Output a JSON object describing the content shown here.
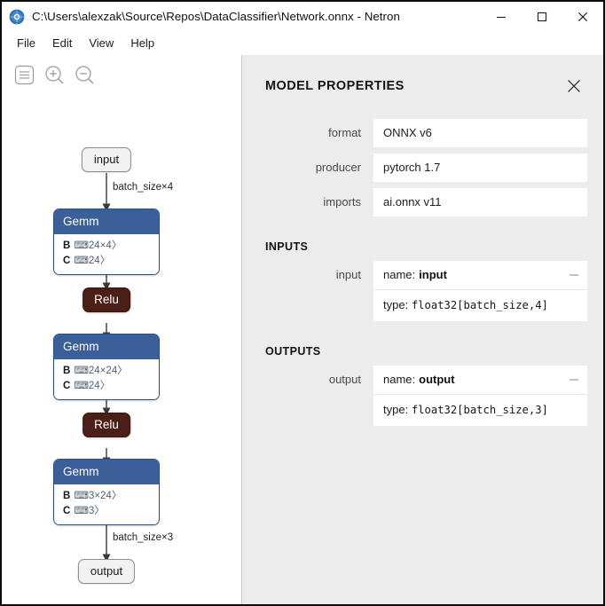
{
  "window": {
    "title": "C:\\Users\\alexzak\\Source\\Repos\\DataClassifier\\Network.onnx - Netron",
    "app_icon": "netron-logo-icon",
    "controls": {
      "minimize": "─",
      "maximize": "☐",
      "close": "✕"
    }
  },
  "menubar": {
    "items": [
      {
        "label": "File"
      },
      {
        "label": "Edit"
      },
      {
        "label": "View"
      },
      {
        "label": "Help"
      }
    ]
  },
  "toolbar": {
    "buttons": [
      {
        "icon": "menu-icon",
        "label": "Menu"
      },
      {
        "icon": "zoom-in-icon",
        "label": "Zoom In"
      },
      {
        "icon": "zoom-out-icon",
        "label": "Zoom Out"
      }
    ]
  },
  "graph": {
    "nodes": [
      {
        "id": "input",
        "kind": "io",
        "label": "input"
      },
      {
        "id": "gemm1",
        "kind": "op",
        "label": "Gemm",
        "attrs": [
          {
            "key": "B",
            "value": "⌨24×4〉"
          },
          {
            "key": "C",
            "value": "⌨24〉"
          }
        ]
      },
      {
        "id": "relu1",
        "kind": "act",
        "label": "Relu"
      },
      {
        "id": "gemm2",
        "kind": "op",
        "label": "Gemm",
        "attrs": [
          {
            "key": "B",
            "value": "⌨24×24〉"
          },
          {
            "key": "C",
            "value": "⌨24〉"
          }
        ]
      },
      {
        "id": "relu2",
        "kind": "act",
        "label": "Relu"
      },
      {
        "id": "gemm3",
        "kind": "op",
        "label": "Gemm",
        "attrs": [
          {
            "key": "B",
            "value": "⌨3×24〉"
          },
          {
            "key": "C",
            "value": "⌨3〉"
          }
        ]
      },
      {
        "id": "output",
        "kind": "io",
        "label": "output"
      }
    ],
    "edge_labels": [
      {
        "id": "e_in",
        "text": "batch_size×4"
      },
      {
        "id": "e_out",
        "text": "batch_size×3"
      }
    ]
  },
  "sidebar": {
    "title": "MODEL PROPERTIES",
    "close_icon": "close-icon",
    "properties": [
      {
        "label": "format",
        "value": "ONNX v6"
      },
      {
        "label": "producer",
        "value": "pytorch 1.7"
      },
      {
        "label": "imports",
        "value": "ai.onnx v11"
      }
    ],
    "inputs": {
      "section": "INPUTS",
      "items": [
        {
          "label": "input",
          "name_prefix": "name:",
          "name": "input",
          "type_prefix": "type:",
          "type": "float32[batch_size,4]"
        }
      ]
    },
    "outputs": {
      "section": "OUTPUTS",
      "items": [
        {
          "label": "output",
          "name_prefix": "name:",
          "name": "output",
          "type_prefix": "type:",
          "type": "float32[batch_size,3]"
        }
      ]
    }
  },
  "colors": {
    "op_header": "#3a5f99",
    "activation": "#4b1f16",
    "sidebar_bg": "#ececec",
    "canvas_bg": "#ffffff",
    "field_bg": "#ffffff"
  }
}
